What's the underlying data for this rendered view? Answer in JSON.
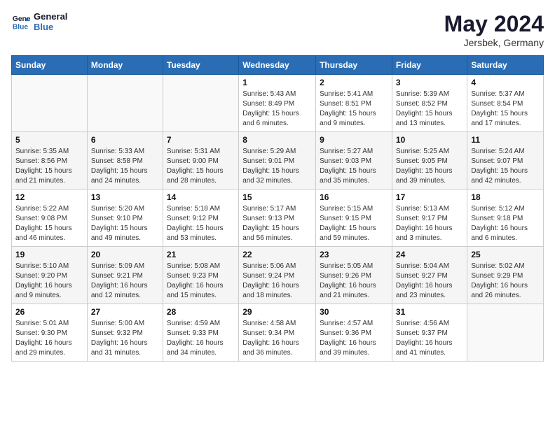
{
  "logo": {
    "line1": "General",
    "line2": "Blue"
  },
  "title": "May 2024",
  "location": "Jersbek, Germany",
  "days_header": [
    "Sunday",
    "Monday",
    "Tuesday",
    "Wednesday",
    "Thursday",
    "Friday",
    "Saturday"
  ],
  "weeks": [
    [
      {
        "num": "",
        "info": ""
      },
      {
        "num": "",
        "info": ""
      },
      {
        "num": "",
        "info": ""
      },
      {
        "num": "1",
        "info": "Sunrise: 5:43 AM\nSunset: 8:49 PM\nDaylight: 15 hours\nand 6 minutes."
      },
      {
        "num": "2",
        "info": "Sunrise: 5:41 AM\nSunset: 8:51 PM\nDaylight: 15 hours\nand 9 minutes."
      },
      {
        "num": "3",
        "info": "Sunrise: 5:39 AM\nSunset: 8:52 PM\nDaylight: 15 hours\nand 13 minutes."
      },
      {
        "num": "4",
        "info": "Sunrise: 5:37 AM\nSunset: 8:54 PM\nDaylight: 15 hours\nand 17 minutes."
      }
    ],
    [
      {
        "num": "5",
        "info": "Sunrise: 5:35 AM\nSunset: 8:56 PM\nDaylight: 15 hours\nand 21 minutes."
      },
      {
        "num": "6",
        "info": "Sunrise: 5:33 AM\nSunset: 8:58 PM\nDaylight: 15 hours\nand 24 minutes."
      },
      {
        "num": "7",
        "info": "Sunrise: 5:31 AM\nSunset: 9:00 PM\nDaylight: 15 hours\nand 28 minutes."
      },
      {
        "num": "8",
        "info": "Sunrise: 5:29 AM\nSunset: 9:01 PM\nDaylight: 15 hours\nand 32 minutes."
      },
      {
        "num": "9",
        "info": "Sunrise: 5:27 AM\nSunset: 9:03 PM\nDaylight: 15 hours\nand 35 minutes."
      },
      {
        "num": "10",
        "info": "Sunrise: 5:25 AM\nSunset: 9:05 PM\nDaylight: 15 hours\nand 39 minutes."
      },
      {
        "num": "11",
        "info": "Sunrise: 5:24 AM\nSunset: 9:07 PM\nDaylight: 15 hours\nand 42 minutes."
      }
    ],
    [
      {
        "num": "12",
        "info": "Sunrise: 5:22 AM\nSunset: 9:08 PM\nDaylight: 15 hours\nand 46 minutes."
      },
      {
        "num": "13",
        "info": "Sunrise: 5:20 AM\nSunset: 9:10 PM\nDaylight: 15 hours\nand 49 minutes."
      },
      {
        "num": "14",
        "info": "Sunrise: 5:18 AM\nSunset: 9:12 PM\nDaylight: 15 hours\nand 53 minutes."
      },
      {
        "num": "15",
        "info": "Sunrise: 5:17 AM\nSunset: 9:13 PM\nDaylight: 15 hours\nand 56 minutes."
      },
      {
        "num": "16",
        "info": "Sunrise: 5:15 AM\nSunset: 9:15 PM\nDaylight: 15 hours\nand 59 minutes."
      },
      {
        "num": "17",
        "info": "Sunrise: 5:13 AM\nSunset: 9:17 PM\nDaylight: 16 hours\nand 3 minutes."
      },
      {
        "num": "18",
        "info": "Sunrise: 5:12 AM\nSunset: 9:18 PM\nDaylight: 16 hours\nand 6 minutes."
      }
    ],
    [
      {
        "num": "19",
        "info": "Sunrise: 5:10 AM\nSunset: 9:20 PM\nDaylight: 16 hours\nand 9 minutes."
      },
      {
        "num": "20",
        "info": "Sunrise: 5:09 AM\nSunset: 9:21 PM\nDaylight: 16 hours\nand 12 minutes."
      },
      {
        "num": "21",
        "info": "Sunrise: 5:08 AM\nSunset: 9:23 PM\nDaylight: 16 hours\nand 15 minutes."
      },
      {
        "num": "22",
        "info": "Sunrise: 5:06 AM\nSunset: 9:24 PM\nDaylight: 16 hours\nand 18 minutes."
      },
      {
        "num": "23",
        "info": "Sunrise: 5:05 AM\nSunset: 9:26 PM\nDaylight: 16 hours\nand 21 minutes."
      },
      {
        "num": "24",
        "info": "Sunrise: 5:04 AM\nSunset: 9:27 PM\nDaylight: 16 hours\nand 23 minutes."
      },
      {
        "num": "25",
        "info": "Sunrise: 5:02 AM\nSunset: 9:29 PM\nDaylight: 16 hours\nand 26 minutes."
      }
    ],
    [
      {
        "num": "26",
        "info": "Sunrise: 5:01 AM\nSunset: 9:30 PM\nDaylight: 16 hours\nand 29 minutes."
      },
      {
        "num": "27",
        "info": "Sunrise: 5:00 AM\nSunset: 9:32 PM\nDaylight: 16 hours\nand 31 minutes."
      },
      {
        "num": "28",
        "info": "Sunrise: 4:59 AM\nSunset: 9:33 PM\nDaylight: 16 hours\nand 34 minutes."
      },
      {
        "num": "29",
        "info": "Sunrise: 4:58 AM\nSunset: 9:34 PM\nDaylight: 16 hours\nand 36 minutes."
      },
      {
        "num": "30",
        "info": "Sunrise: 4:57 AM\nSunset: 9:36 PM\nDaylight: 16 hours\nand 39 minutes."
      },
      {
        "num": "31",
        "info": "Sunrise: 4:56 AM\nSunset: 9:37 PM\nDaylight: 16 hours\nand 41 minutes."
      },
      {
        "num": "",
        "info": ""
      }
    ]
  ]
}
